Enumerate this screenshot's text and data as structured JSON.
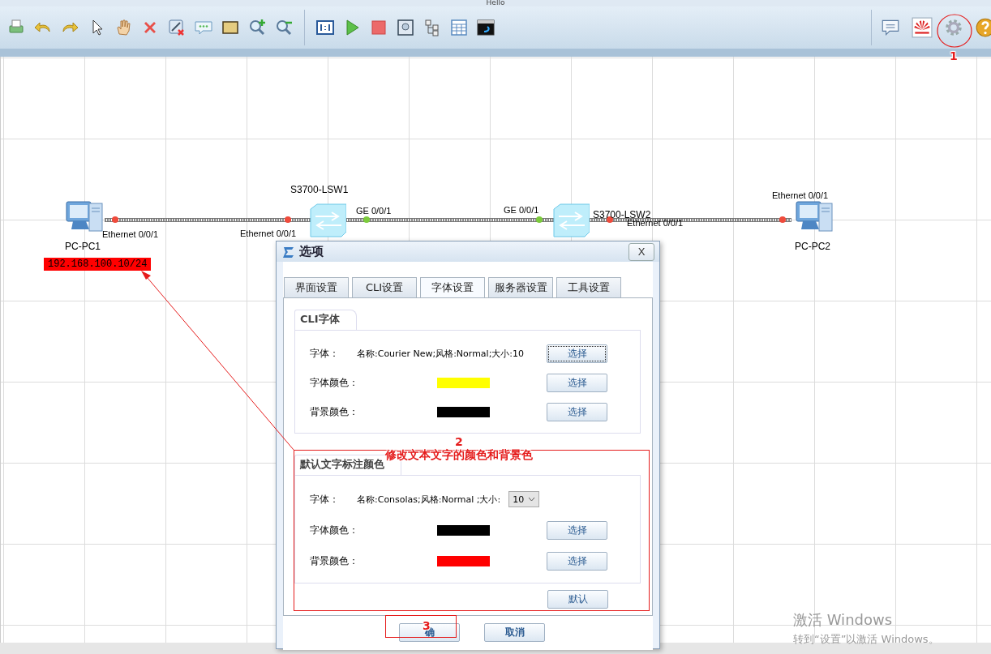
{
  "window": {
    "title": "Hello"
  },
  "topology": {
    "devices": [
      {
        "kind": "pc",
        "name": "PC-PC1",
        "note": "192.168.100.10/24"
      },
      {
        "kind": "switch",
        "name": "S3700-LSW1"
      },
      {
        "kind": "switch",
        "name": "S3700-LSW2"
      },
      {
        "kind": "pc",
        "name": "PC-PC2"
      }
    ],
    "ports": [
      {
        "label": "Ethernet 0/0/1",
        "color": "#ef4b3c"
      },
      {
        "label": "Ethernet 0/0/1",
        "color": "#ef4b3c"
      },
      {
        "label": "GE 0/0/1",
        "color": "#7ccb3c"
      },
      {
        "label": "GE 0/0/1",
        "color": "#7ccb3c"
      },
      {
        "label": "Ethernet 0/0/1",
        "color": "#ef4b3c"
      },
      {
        "label": "Ethernet 0/0/1",
        "color": "#ef4b3c"
      }
    ]
  },
  "dialog": {
    "title": "选项",
    "close": "X",
    "tabs": [
      {
        "label": "界面设置",
        "selected": false
      },
      {
        "label": "CLI设置",
        "selected": false
      },
      {
        "label": "字体设置",
        "selected": true
      },
      {
        "label": "服务器设置",
        "selected": false
      },
      {
        "label": "工具设置",
        "selected": false
      }
    ],
    "groups": [
      {
        "title": "CLI字体",
        "rows": [
          {
            "kind": "font",
            "label": "字体：",
            "value": "名称:Courier New;风格:Normal;大小:10",
            "button": "选择",
            "focused": true
          },
          {
            "kind": "color",
            "label": "字体颜色：",
            "color": "#ffff00",
            "button": "选择",
            "focused": false
          },
          {
            "kind": "color",
            "label": "背景颜色：",
            "color": "#000000",
            "button": "选择",
            "focused": false
          }
        ]
      },
      {
        "title": "默认文字标注颜色",
        "rows": [
          {
            "kind": "font_size",
            "label": "字体：",
            "value": "名称:Consolas;风格:Normal ;大小:",
            "size": "10"
          },
          {
            "kind": "color",
            "label": "字体颜色：",
            "color": "#000000",
            "button": "选择",
            "focused": false
          },
          {
            "kind": "color",
            "label": "背景颜色：",
            "color": "#ff0000",
            "button": "选择",
            "focused": false
          }
        ],
        "default_button": "默认"
      }
    ],
    "buttons": [
      "确",
      "取消"
    ]
  },
  "annotations": [
    {
      "kind": "circle",
      "label": "1"
    },
    {
      "kind": "box",
      "label": "2",
      "text": "修改文本文字的颜色和背景色"
    },
    {
      "kind": "box",
      "label": "3"
    }
  ],
  "os_notice": [
    "激活 Windows",
    "转到“设置”以激活 Windows。"
  ]
}
